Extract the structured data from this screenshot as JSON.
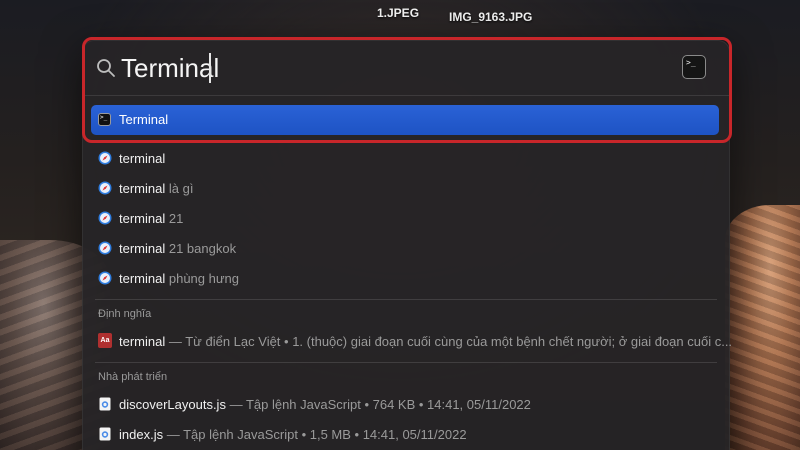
{
  "desktop": {
    "file_1": "1.JPEG",
    "file_2": "IMG_9163.JPG"
  },
  "spotlight": {
    "query": "Terminal",
    "top_hit": {
      "label": "Terminal",
      "icon": "terminal-app-icon"
    },
    "suggestions": [
      {
        "bold": "terminal",
        "rest": ""
      },
      {
        "bold": "terminal",
        "rest": " là gì"
      },
      {
        "bold": "terminal",
        "rest": " 21"
      },
      {
        "bold": "terminal",
        "rest": " 21 bangkok"
      },
      {
        "bold": "terminal",
        "rest": " phùng hưng"
      }
    ],
    "definition_section": {
      "title": "Định nghĩa",
      "word": "terminal",
      "detail": " — Từ điển Lạc Việt • 1. (thuộc) giai đoạn cuối cùng của một bệnh chết người; ở giai đoạn cuối c..."
    },
    "developer_section": {
      "title": "Nhà phát triển",
      "files": [
        {
          "name": "discoverLayouts.js",
          "meta": " — Tập lệnh JavaScript • 764 KB • 14:41, 05/11/2022"
        },
        {
          "name": "index.js",
          "meta": " — Tập lệnh JavaScript • 1,5 MB • 14:41, 05/11/2022"
        }
      ]
    }
  },
  "colors": {
    "highlight_frame": "#c8262a",
    "selection": "#1e53c4"
  }
}
